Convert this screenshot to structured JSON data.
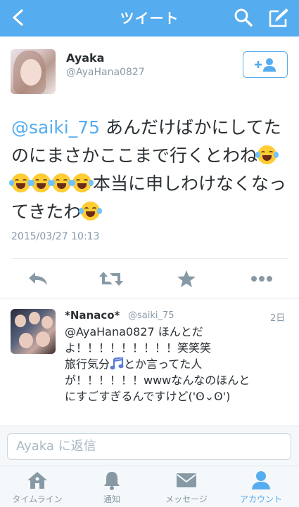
{
  "nav": {
    "title": "ツイート",
    "icons": [
      "back-icon",
      "search-icon",
      "compose-icon"
    ]
  },
  "tweet": {
    "author_name": "Ayaka",
    "author_handle": "@AyaHana0827",
    "mention": "@saiki_75",
    "text_part1": " あんだけばかにしてたのにまさかここまで行くとわね",
    "text_part2": "本当に申しわけなくなってきたわ",
    "emoji": "face-with-tears-of-joy",
    "timestamp": "2015/03/27 10:13"
  },
  "actions": [
    "reply-icon",
    "retweet-icon",
    "favorite-icon",
    "more-icon"
  ],
  "reply": {
    "name": "*Nanaco*",
    "handle": "@saiki_75",
    "time": "2日",
    "line1": "@AyaHana0827 ほんとだ",
    "line2": "よ！！！！！！！！！笑笑笑",
    "line3a": "旅行気分",
    "line3b": "とか言ってた人",
    "line4": "が！！！！！！wwwなんなのほんと",
    "line5": "にすごすぎるんですけど('ʘ⌄ʘ')"
  },
  "composer": {
    "placeholder": "Ayaka に返信"
  },
  "tabs": [
    {
      "label": "タイムライン",
      "icon": "home-icon"
    },
    {
      "label": "通知",
      "icon": "bell-icon"
    },
    {
      "label": "メッセージ",
      "icon": "envelope-icon"
    },
    {
      "label": "アカウント",
      "icon": "person-icon"
    }
  ],
  "colors": {
    "brand": "#55acee",
    "text": "#292f33",
    "muted": "#8899a6",
    "divider": "#e1e8ed"
  }
}
